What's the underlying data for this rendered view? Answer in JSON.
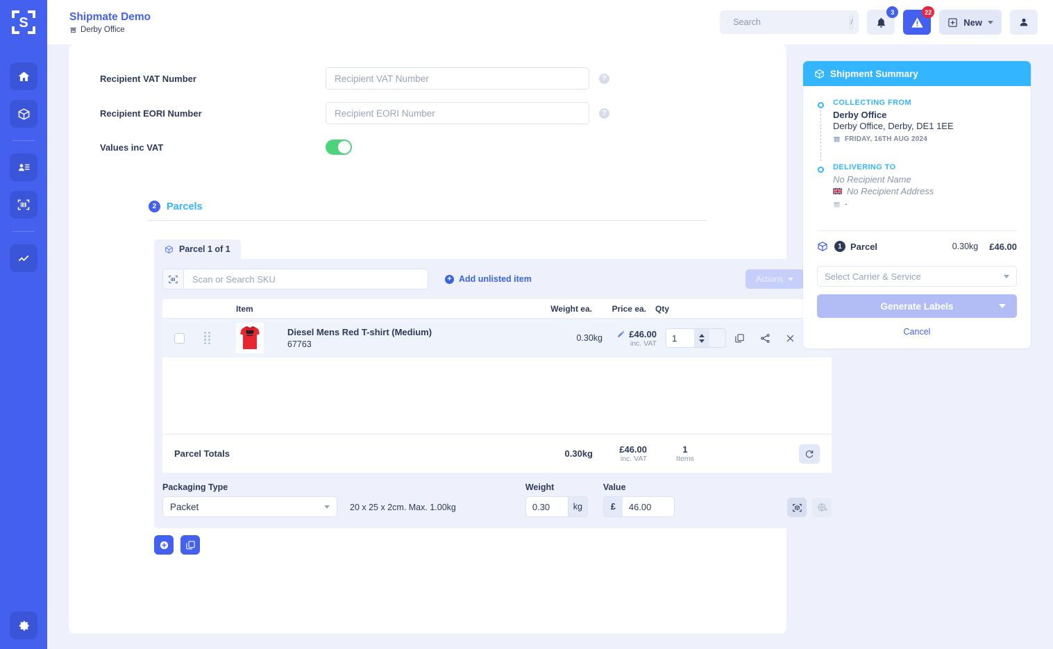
{
  "sidebar": {
    "logo_name": "shipmate-logo",
    "items": [
      {
        "icon": "home-icon",
        "name": "home"
      },
      {
        "icon": "package-icon",
        "name": "shipments"
      },
      {
        "icon": "contacts-icon",
        "name": "contacts"
      },
      {
        "icon": "barcode-scan-icon",
        "name": "scan"
      },
      {
        "icon": "analytics-icon",
        "name": "analytics"
      }
    ],
    "settings_icon": "gear-icon"
  },
  "header": {
    "title": "Shipmate Demo",
    "office": "Derby Office",
    "office_icon": "store-icon",
    "search": {
      "placeholder": "Search",
      "value": "",
      "icon": "search-icon",
      "shortcut": "/"
    },
    "notifications": {
      "icon": "bell-icon",
      "count": "3"
    },
    "alerts": {
      "icon": "warning-triangle-icon",
      "count": "22"
    },
    "new_button": {
      "label": "New",
      "icon": "plus-square-icon"
    },
    "account_icon": "user-icon"
  },
  "form": {
    "vat_number": {
      "label": "Recipient VAT Number",
      "placeholder": "Recipient VAT Number",
      "value": "",
      "help_icon": "question-icon"
    },
    "eori_number": {
      "label": "Recipient EORI Number",
      "placeholder": "Recipient EORI Number",
      "value": "",
      "help_icon": "question-icon"
    },
    "values_inc_vat": {
      "label": "Values inc VAT",
      "state": "on"
    }
  },
  "parcels_section": {
    "step": "2",
    "title": "Parcels",
    "tab_label": "Parcel 1 of 1",
    "tab_icon": "package-icon",
    "toolbar": {
      "sku_placeholder": "Scan or Search SKU",
      "sku_value": "",
      "scan_icon": "barcode-scan-icon",
      "add_unlisted_label": "Add unlisted item",
      "actions_label": "Actions",
      "delete_icon": "trash-icon"
    },
    "table": {
      "columns": [
        "Item",
        "Weight ea.",
        "Price ea.",
        "Qty"
      ],
      "rows": [
        {
          "name": "Diesel Mens Red T-shirt (Medium)",
          "sku": "67763",
          "weight": "0.30kg",
          "price": "£46.00",
          "price_note": "inc. VAT",
          "qty": "1",
          "edit_icon": "pencil-icon",
          "copy_icon": "copy-icon",
          "split_icon": "split-icon",
          "remove_icon": "close-icon",
          "thumb": "red-tshirt-thumbnail"
        }
      ]
    },
    "totals": {
      "label": "Parcel Totals",
      "weight": "0.30kg",
      "price": "£46.00",
      "price_note": "inc. VAT",
      "qty": "1",
      "qty_note": "Items",
      "refresh_icon": "refresh-icon"
    },
    "packaging": {
      "type_label": "Packaging Type",
      "type_value": "Packet",
      "dimensions": "20 x 25 x 2cm. Max. 1.00kg",
      "weight_label": "Weight",
      "weight_value": "0.30",
      "weight_unit": "kg",
      "value_label": "Value",
      "currency_symbol": "£",
      "value_value": "46.00",
      "dims_icon": "cube-scan-icon",
      "globe_icon": "globe-icon"
    },
    "footer_buttons": [
      {
        "icon": "plus-circle-icon",
        "name": "add-parcel"
      },
      {
        "icon": "copy-icon",
        "name": "duplicate-parcel"
      }
    ]
  },
  "summary": {
    "title": "Shipment Summary",
    "title_icon": "package-icon",
    "collecting": {
      "kicker": "COLLECTING FROM",
      "name": "Derby Office",
      "address": "Derby Office, Derby, DE1 1EE",
      "date": "FRIDAY, 16TH AUG 2024",
      "date_icon": "calendar-icon"
    },
    "delivering": {
      "kicker": "DELIVERING TO",
      "name": "No Recipient Name",
      "address": "No Recipient Address",
      "flag": "gb-flag-icon",
      "date": "-",
      "date_icon": "calendar-icon"
    },
    "parcel_line": {
      "icon": "package-icon",
      "count": "1",
      "label": "Parcel",
      "weight": "0.30kg",
      "value": "£46.00"
    },
    "carrier_select": {
      "placeholder": "Select Carrier & Service",
      "value": ""
    },
    "generate_button": "Generate Labels",
    "cancel_link": "Cancel"
  },
  "colors": {
    "brand_blue": "#4361ee",
    "accent_cyan": "#33b5ff",
    "toggle_green": "#4cd37c",
    "alert_red": "#e6273e",
    "page_bg": "#eef1fb"
  }
}
